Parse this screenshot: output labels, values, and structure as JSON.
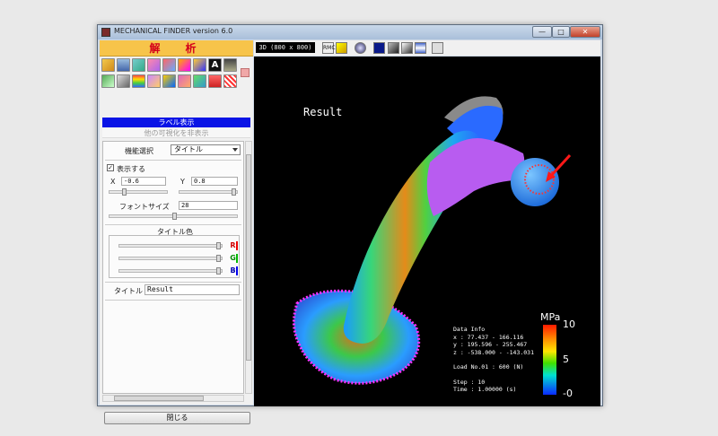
{
  "window": {
    "title": "MECHANICAL FINDER version 6.0",
    "buttons": {
      "minimize": "—",
      "maximize": "□",
      "close": "✕"
    }
  },
  "left_panel": {
    "header": "解　析",
    "tabs": [
      "ラベル表示",
      "他の可視化を非表示"
    ],
    "function_select_label": "機能選択",
    "function_select_value": "タイトル",
    "show_checkbox_label": "表示する",
    "show_checkbox_checked": true,
    "x_label": "X",
    "x_value": "-0.6",
    "y_label": "Y",
    "y_value": "0.8",
    "font_size_label": "フォントサイズ",
    "font_size_value": "28",
    "title_color_label": "タイトル色",
    "rgb_labels": [
      "R",
      "G",
      "B"
    ],
    "title_label": "タイトル",
    "title_value": "Result",
    "close_button": "閉じる"
  },
  "view": {
    "size_display": "3D (800 x 800)",
    "result_label": "Result",
    "data_info": {
      "heading": "Data Info",
      "x": "x : 77.437 - 166.116",
      "y": "y : 195.596 - 255.467",
      "z": "z : -538.000 - -143.031",
      "load": "Load No.01 : 600 (N)",
      "step": "Step : 10",
      "time": "Time : 1.00000 (s)"
    },
    "colorbar": {
      "unit": "MPa",
      "max": "10",
      "mid": "5",
      "min": "-0"
    }
  },
  "colors": {
    "accent": "#f7c44a",
    "active_tab": "#0a14e6",
    "viewport": "#000000"
  }
}
